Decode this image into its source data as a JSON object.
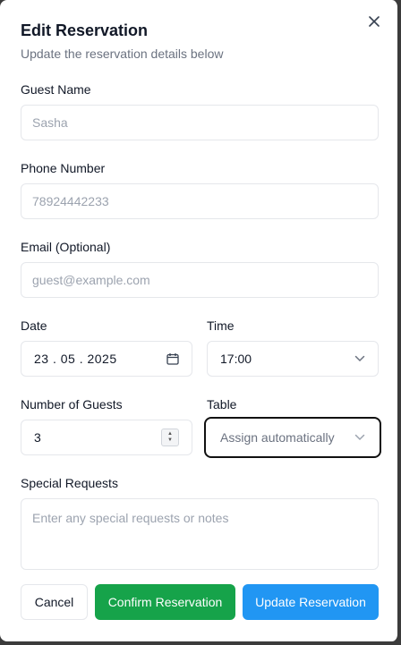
{
  "dialog": {
    "title": "Edit Reservation",
    "subtitle": "Update the reservation details below"
  },
  "form": {
    "guest_name": {
      "label": "Guest Name",
      "value": "",
      "placeholder": "Sasha"
    },
    "phone": {
      "label": "Phone Number",
      "value": "",
      "placeholder": "78924442233"
    },
    "email": {
      "label": "Email (Optional)",
      "value": "",
      "placeholder": "guest@example.com"
    },
    "date": {
      "label": "Date",
      "value": "23 . 05 . 2025"
    },
    "time": {
      "label": "Time",
      "value": "17:00"
    },
    "guests": {
      "label": "Number of Guests",
      "value": "3"
    },
    "table": {
      "label": "Table",
      "value": "Assign automatically"
    },
    "special_requests": {
      "label": "Special Requests",
      "value": "",
      "placeholder": "Enter any special requests or notes"
    }
  },
  "buttons": {
    "cancel": "Cancel",
    "confirm": "Confirm Reservation",
    "update": "Update Reservation"
  },
  "colors": {
    "confirm": "#16a34a",
    "update": "#2196f3",
    "focus_border": "#111111"
  }
}
